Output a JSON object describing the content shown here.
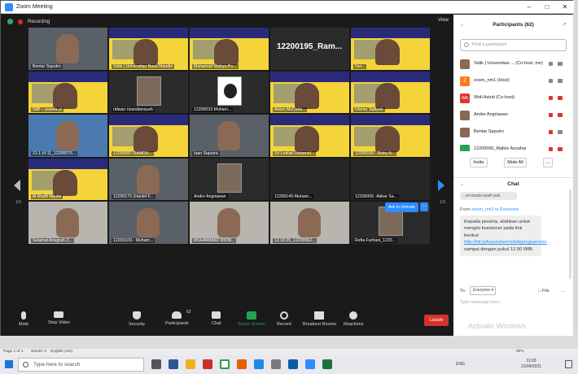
{
  "window": {
    "title": "Zoom Meeting"
  },
  "topbar": {
    "recording": "Recording",
    "view": "View"
  },
  "page_indicator": {
    "left": "1/3",
    "right": "1/3"
  },
  "tiles": [
    {
      "name": "Bentar Saputro",
      "kind": "cam"
    },
    {
      "name": "Sidik | Universitas Nusa Mandiri",
      "kind": "banner"
    },
    {
      "name": "Muhamad Wahyu Pu...",
      "kind": "banner"
    },
    {
      "name": "",
      "kind": "bigtext",
      "text": "12200195_Ram..."
    },
    {
      "name": "Nur...",
      "kind": "banner"
    },
    {
      "name": "Stiff -- yusefa yt",
      "kind": "banner"
    },
    {
      "name": "ridwan rizandiansyah",
      "kind": "photo"
    },
    {
      "name": "12200033 Muham...",
      "kind": "logo"
    },
    {
      "name": "Anton McCorki...",
      "kind": "banner"
    },
    {
      "name": "Ummu Tadiyah",
      "kind": "banner"
    },
    {
      "name": "12.1 (4 11_12200076...",
      "kind": "cam"
    },
    {
      "name": "12200087 RAMDH...",
      "kind": "banner"
    },
    {
      "name": "Iqan Saputra",
      "kind": "cam"
    },
    {
      "name": "Sri Lestari Universit...",
      "kind": "banner"
    },
    {
      "name": "12200100 - Rizky A...",
      "kind": "banner"
    },
    {
      "name": "M.Ahaffi Naufal",
      "kind": "banner"
    },
    {
      "name": "12200175 (Hanief F...",
      "kind": "cam"
    },
    {
      "name": "Andre Angriawan",
      "kind": "photo"
    },
    {
      "name": "12200145-Muham...",
      "kind": "dark"
    },
    {
      "name": "12200006 -Akbar Sa...",
      "kind": "dark"
    },
    {
      "name": "Selamat Anugrah Z...",
      "kind": "cam"
    },
    {
      "name": "12200109 - Muham...",
      "kind": "cam"
    },
    {
      "name": "MUHAMMAD RIDW...",
      "kind": "cam"
    },
    {
      "name": "12.18.05_12200062...",
      "kind": "cam"
    },
    {
      "name": "Refia Farhani_1220...",
      "kind": "photo"
    }
  ],
  "buttons": {
    "ask_unmute": "Ask to Unmute",
    "more": "..."
  },
  "toolbar": {
    "mute": "Mute",
    "stop_video": "Stop Video",
    "security": "Security",
    "participants": "Participants",
    "participants_count": "62",
    "chat": "Chat",
    "share_screen": "Share Screen",
    "record": "Record",
    "breakout_rooms": "Breakout Rooms",
    "reactions": "Reactions",
    "leave": "Leave"
  },
  "participants_panel": {
    "header": "Participants (62)",
    "search_placeholder": "Find a participant",
    "rows": [
      {
        "name": "Sidik | Universitas ... (Co-host, me)",
        "avatar": "",
        "av_style": "",
        "mic": "",
        "cam": ""
      },
      {
        "name": "zoom_nm1 (Host)",
        "avatar": "Z",
        "av_style": "orange",
        "mic": "",
        "cam": ""
      },
      {
        "name": "Widi Astuti (Co-host)",
        "avatar": "WA",
        "av_style": "red",
        "mic": "red",
        "cam": "red"
      },
      {
        "name": "Andre Angriawan",
        "avatar": "",
        "av_style": "",
        "mic": "red",
        "cam": "red"
      },
      {
        "name": "Bentar Saputro",
        "avatar": "",
        "av_style": "",
        "mic": "red",
        "cam": ""
      },
      {
        "name": "12200000_Malkie Azsahar",
        "avatar": "",
        "av_style": "green",
        "mic": "red",
        "cam": "red"
      }
    ],
    "invite": "Invite",
    "mute_all": "Mute All",
    "more": "..."
  },
  "chat_panel": {
    "header": "Chat",
    "prev_msg": "...en-tanda kasih pak",
    "from_prefix": "From",
    "from_name": "zoom_nm1",
    "to_text": "to Everyone",
    "message_before_link": "Kepada peserta, silahkan untuk mengisi kuesioner pada link berikut:",
    "message_link": "http://bit.ly/kuesionermobileprogrammer",
    "message_after_link": "sampai dengan pukul 12.00 WIB.",
    "to_label": "To:",
    "to_value": "Everyone",
    "file": "File",
    "more": "...",
    "placeholder": "Type message here...",
    "watermark": "Activate Windows"
  },
  "statusbar": {
    "page": "Page 1 of 1",
    "words": "Words: 0",
    "lang": "English (US)",
    "zoom": "90%"
  },
  "taskbar": {
    "search": "Type here to search",
    "lang": "ENG",
    "time": "11:03",
    "date": "21/04/2021"
  }
}
